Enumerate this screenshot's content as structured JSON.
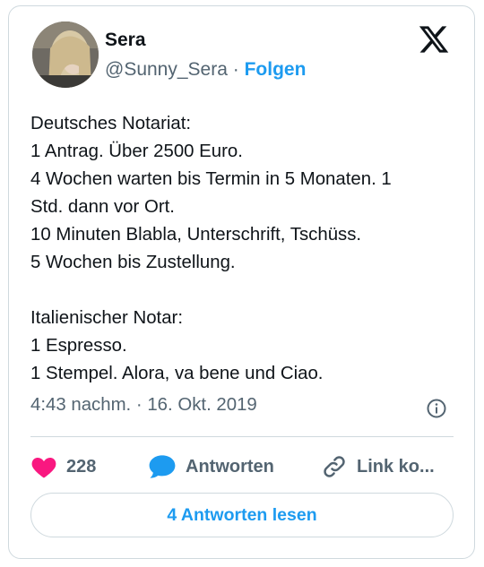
{
  "author": {
    "name": "Sera",
    "handle": "@Sunny_Sera",
    "separator": "·",
    "follow_label": "Folgen"
  },
  "tweet": {
    "lines": [
      "Deutsches Notariat:",
      "1 Antrag. Über 2500 Euro.",
      "4 Wochen warten bis Termin in 5 Monaten. 1",
      "Std. dann vor Ort.",
      "10 Minuten Blabla, Unterschrift, Tschüss.",
      "5 Wochen bis Zustellung.",
      "",
      "Italienischer Notar:",
      "1 Espresso.",
      "1 Stempel. Alora, va bene und Ciao."
    ],
    "timestamp": "4:43 nachm. · 16. Okt. 2019"
  },
  "actions": {
    "like_count": "228",
    "reply_label": "Antworten",
    "copy_link_label": "Link ko..."
  },
  "read_replies_label": "4 Antworten lesen",
  "colors": {
    "accent": "#1d9bf0",
    "like": "#f91880",
    "muted": "#536471",
    "border": "#cfd9de"
  },
  "icons": {
    "brand": "x-logo-icon",
    "info": "info-icon",
    "like": "heart-icon",
    "reply": "speech-bubble-icon",
    "link": "link-icon"
  }
}
